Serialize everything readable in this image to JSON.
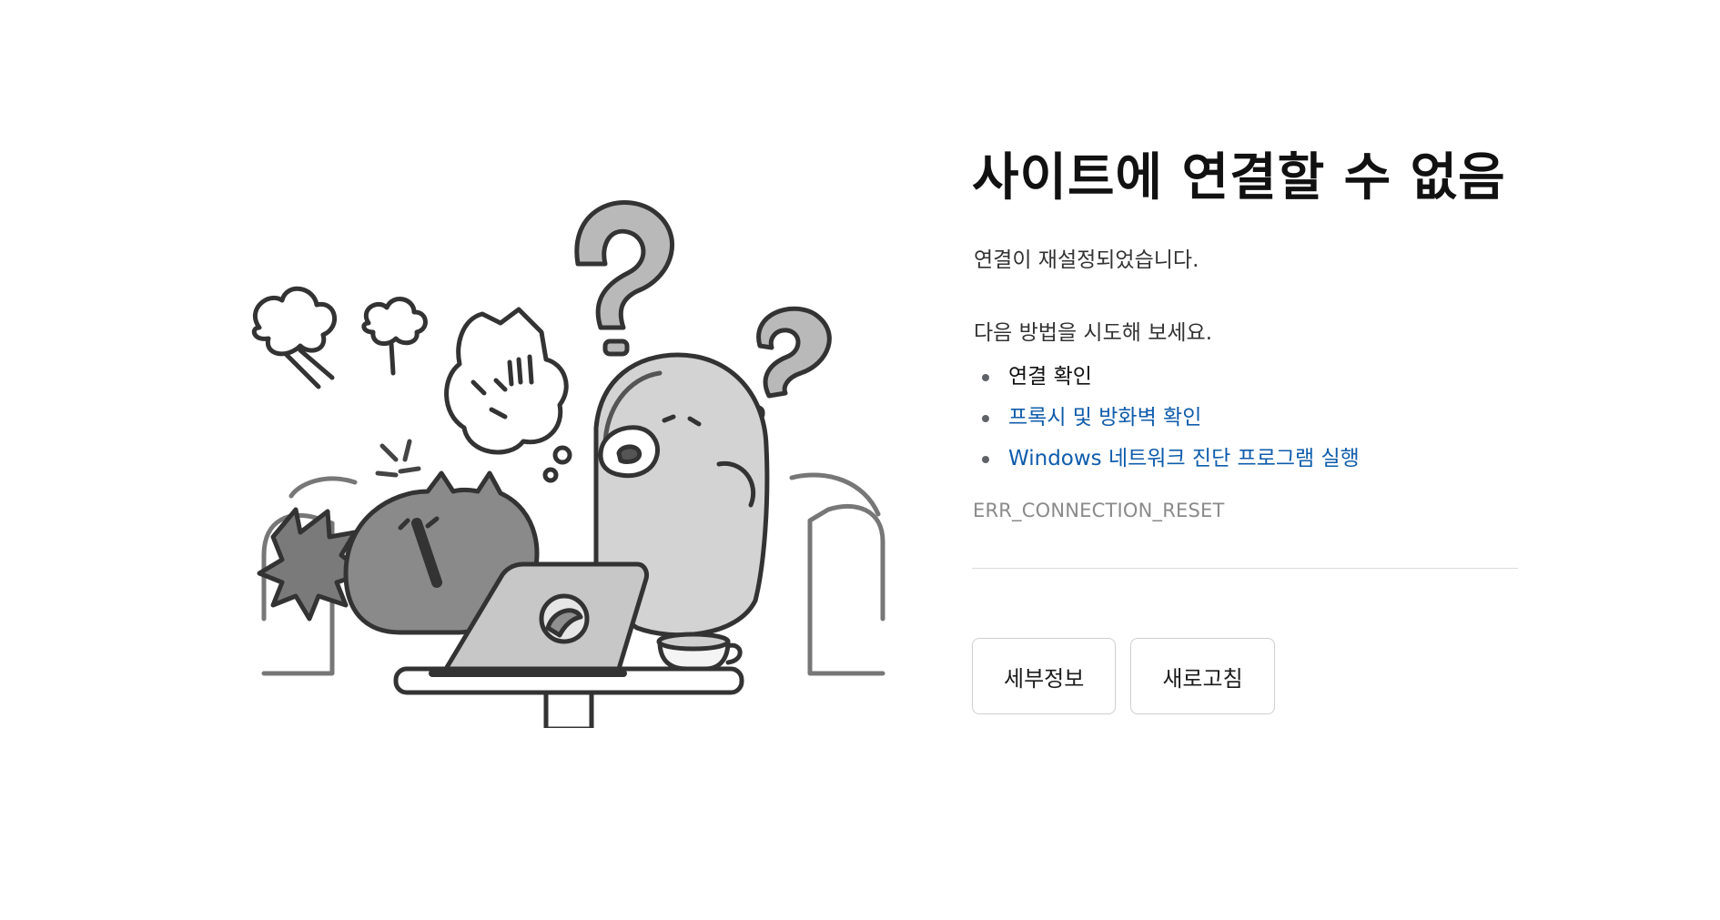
{
  "error_page": {
    "title": "사이트에 연결할 수 없음",
    "message": "연결이 재설정되었습니다.",
    "try_heading": "다음 방법을 시도해 보세요.",
    "suggestions": [
      {
        "label": "연결 확인",
        "is_link": false
      },
      {
        "label": "프록시 및 방화벽 확인",
        "is_link": true
      },
      {
        "label": "Windows 네트워크 진단 프로그램 실행",
        "is_link": true
      }
    ],
    "error_code": "ERR_CONNECTION_RESET",
    "buttons": {
      "details_label": "세부정보",
      "refresh_label": "새로고침"
    }
  },
  "colors": {
    "link": "#0f5cab",
    "error_code": "#8a8a8a",
    "divider": "#dcdcdc"
  },
  "illustration": {
    "icon": "confused-cat-and-penguin-with-laptop-illustration"
  }
}
